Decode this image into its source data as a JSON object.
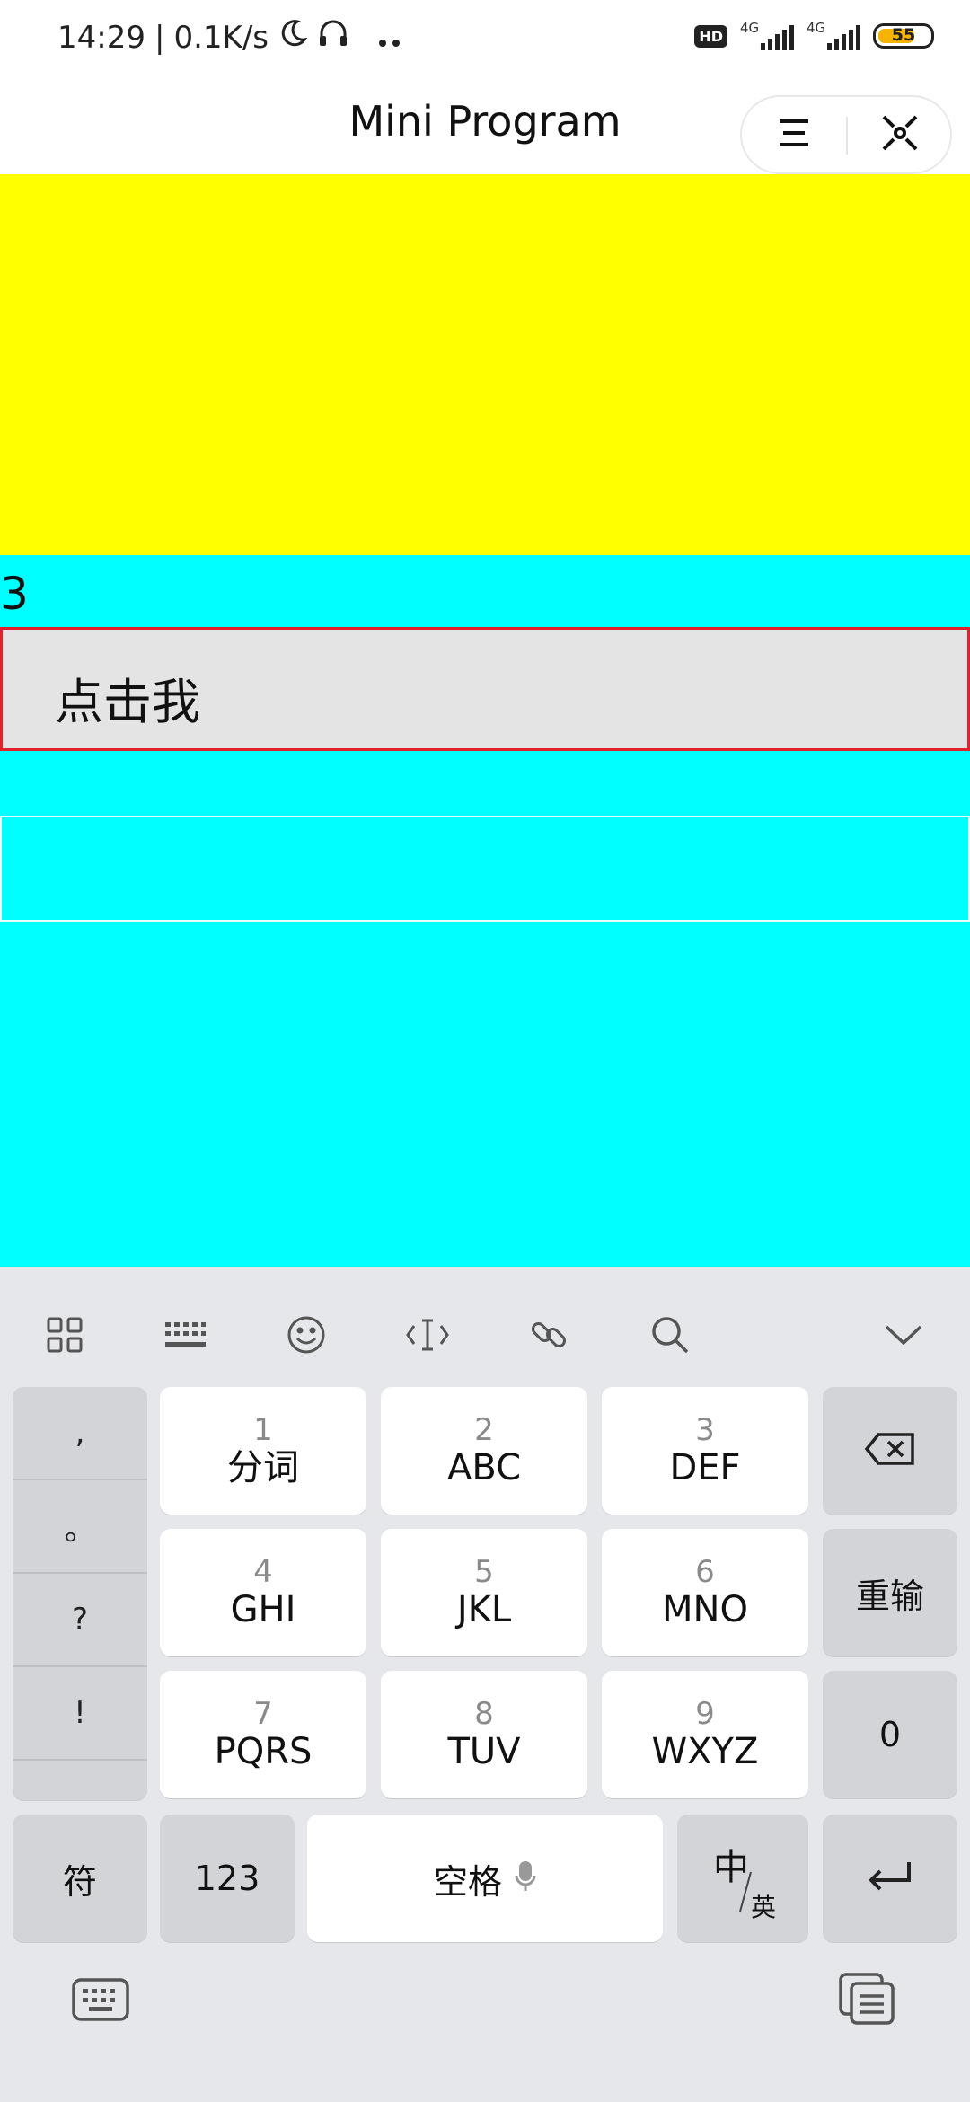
{
  "status_bar": {
    "time": "14:29",
    "separator": "|",
    "net_speed": "0.1K/s",
    "hd_badge": "HD",
    "sim1_net": "4G",
    "sim2_net": "4G",
    "battery": "55",
    "icons": [
      "moon-icon",
      "headset-icon",
      "dots-icon",
      "hd-icon",
      "signal-icon",
      "signal-icon",
      "battery-icon"
    ]
  },
  "nav": {
    "title": "Mini Program",
    "menu_icon": "menu-icon",
    "close_icon": "close-icon"
  },
  "content": {
    "counter": "3",
    "button_label": "点击我",
    "input_value": "",
    "colors": {
      "top_block": "#ffff00",
      "main_block": "#00ffff",
      "button_border": "#e0202a"
    }
  },
  "keyboard": {
    "toolbar_icons": [
      "grid-icon",
      "keyboard-icon",
      "emoji-icon",
      "cursor-icon",
      "link-icon",
      "search-icon",
      "collapse-icon"
    ],
    "punctuation": [
      ",",
      "。",
      "?",
      "!",
      ""
    ],
    "keys": [
      {
        "num": "1",
        "letters": "分词"
      },
      {
        "num": "2",
        "letters": "ABC"
      },
      {
        "num": "3",
        "letters": "DEF"
      },
      {
        "num": "4",
        "letters": "GHI"
      },
      {
        "num": "5",
        "letters": "JKL"
      },
      {
        "num": "6",
        "letters": "MNO"
      },
      {
        "num": "7",
        "letters": "PQRS"
      },
      {
        "num": "8",
        "letters": "TUV"
      },
      {
        "num": "9",
        "letters": "WXYZ"
      }
    ],
    "reenter": "重输",
    "zero": "0",
    "symbols": "符",
    "numbers": "123",
    "space": "空格",
    "lang_main": "中",
    "lang_sub": "英",
    "backspace_icon": "backspace-icon",
    "enter_icon": "enter-icon",
    "mic_icon": "mic-icon",
    "bottom_icons": [
      "keyboard-switch-icon",
      "clipboard-icon"
    ]
  }
}
